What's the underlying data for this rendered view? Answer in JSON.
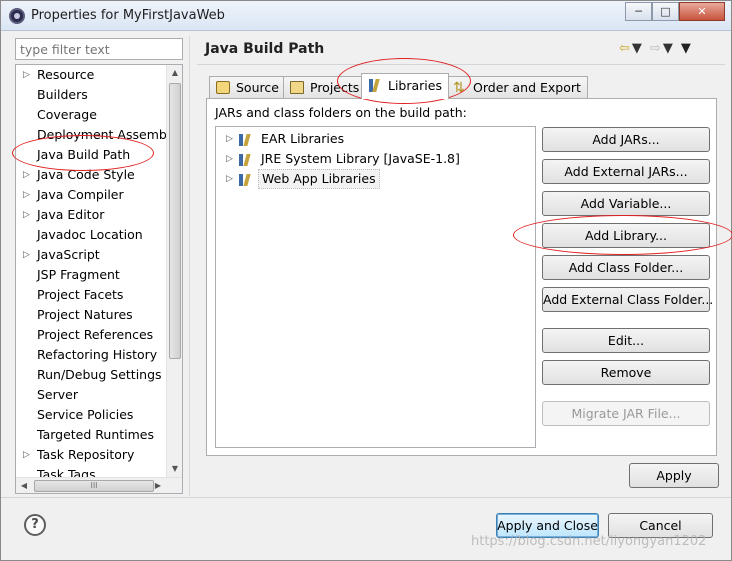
{
  "window": {
    "title": "Properties for MyFirstJavaWeb",
    "controls": [
      "─",
      "□",
      "✕"
    ]
  },
  "filter": {
    "placeholder": "type filter text"
  },
  "nav": {
    "items": [
      {
        "label": "Resource",
        "expandable": true
      },
      {
        "label": "Builders",
        "expandable": false
      },
      {
        "label": "Coverage",
        "expandable": false
      },
      {
        "label": "Deployment Assembly",
        "expandable": false
      },
      {
        "label": "Java Build Path",
        "expandable": false,
        "highlighted": true
      },
      {
        "label": "Java Code Style",
        "expandable": true
      },
      {
        "label": "Java Compiler",
        "expandable": true
      },
      {
        "label": "Java Editor",
        "expandable": true
      },
      {
        "label": "Javadoc Location",
        "expandable": false
      },
      {
        "label": "JavaScript",
        "expandable": true
      },
      {
        "label": "JSP Fragment",
        "expandable": false
      },
      {
        "label": "Project Facets",
        "expandable": false
      },
      {
        "label": "Project Natures",
        "expandable": false
      },
      {
        "label": "Project References",
        "expandable": false
      },
      {
        "label": "Refactoring History",
        "expandable": false
      },
      {
        "label": "Run/Debug Settings",
        "expandable": false
      },
      {
        "label": "Server",
        "expandable": false
      },
      {
        "label": "Service Policies",
        "expandable": false
      },
      {
        "label": "Targeted Runtimes",
        "expandable": false
      },
      {
        "label": "Task Repository",
        "expandable": true
      },
      {
        "label": "Task Tags",
        "expandable": false
      }
    ],
    "hscroll_thumb": "III"
  },
  "page": {
    "title": "Java Build Path",
    "tabs": [
      {
        "label": "Source",
        "icon": "source-folder-icon"
      },
      {
        "label": "Projects",
        "icon": "projects-icon"
      },
      {
        "label": "Libraries",
        "icon": "libraries-icon",
        "active": true
      },
      {
        "label": "Order and Export",
        "icon": "order-export-icon"
      }
    ],
    "panel_label": "JARs and class folders on the build path:",
    "libraries": [
      {
        "label": "EAR Libraries"
      },
      {
        "label": "JRE System Library [JavaSE-1.8]"
      },
      {
        "label": "Web App Libraries",
        "selected": true
      }
    ],
    "buttons": [
      {
        "label": "Add JARs...",
        "enabled": true
      },
      {
        "label": "Add External JARs...",
        "enabled": true
      },
      {
        "label": "Add Variable...",
        "enabled": true
      },
      {
        "label": "Add Library...",
        "enabled": true,
        "highlighted": true
      },
      {
        "label": "Add Class Folder...",
        "enabled": true
      },
      {
        "label": "Add External Class Folder...",
        "enabled": true
      },
      {
        "label": "Edit...",
        "enabled": true
      },
      {
        "label": "Remove",
        "enabled": true
      },
      {
        "label": "Migrate JAR File...",
        "enabled": false
      }
    ],
    "apply_label": "Apply"
  },
  "footer": {
    "help": "?",
    "apply_close_label": "Apply and Close",
    "cancel_label": "Cancel",
    "watermark": "https://blog.csdn.net/liyongyan1202"
  },
  "colors": {
    "annotation": "#e02020",
    "default_button_border": "#3c7fb1"
  }
}
